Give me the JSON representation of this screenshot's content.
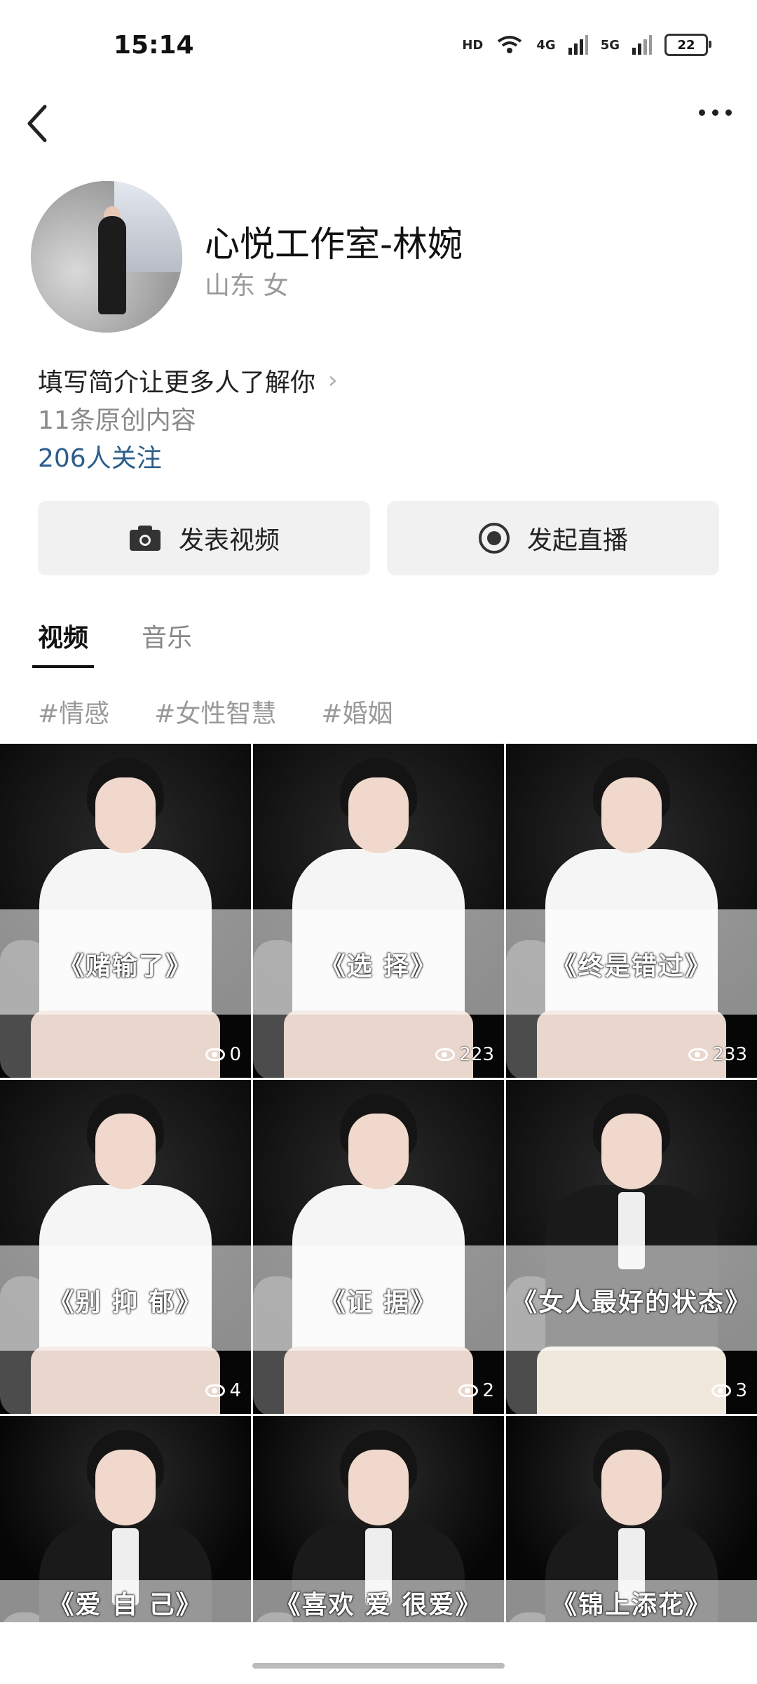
{
  "status": {
    "time": "15:14",
    "battery": "22",
    "hd": "HD",
    "net1": "4G",
    "net2": "5G"
  },
  "profile": {
    "name": "心悦工作室-林婉",
    "location": "山东 女",
    "bio_prompt": "填写简介让更多人了解你",
    "original_count": "11条原创内容",
    "followers": "206人关注"
  },
  "actions": {
    "post_video": "发表视频",
    "start_live": "发起直播"
  },
  "tabs": [
    {
      "label": "视频"
    },
    {
      "label": "音乐"
    }
  ],
  "tags": [
    "#情感",
    "#女性智慧",
    "#婚姻"
  ],
  "videos": [
    {
      "title": "《赌输了》",
      "views": "0",
      "style": "white"
    },
    {
      "title": "《选 择》",
      "views": "223",
      "style": "white"
    },
    {
      "title": "《终是错过》",
      "views": "233",
      "style": "white"
    },
    {
      "title": "《别 抑 郁》",
      "views": "4",
      "style": "white"
    },
    {
      "title": "《证 据》",
      "views": "2",
      "style": "white"
    },
    {
      "title": "《女人最好的状态》",
      "views": "3",
      "style": "dark"
    },
    {
      "title": "《爱 自 己》",
      "views": "",
      "style": "dark"
    },
    {
      "title": "《喜欢 爱 很爱》",
      "views": "",
      "style": "dark"
    },
    {
      "title": "《锦上添花》",
      "views": "",
      "style": "dark"
    }
  ],
  "icons": {
    "back": "back-arrow-icon",
    "more": "more-dots-icon",
    "camera": "camera-icon",
    "live": "live-record-icon",
    "chevron": "chevron-right-icon",
    "eye": "eye-icon"
  }
}
